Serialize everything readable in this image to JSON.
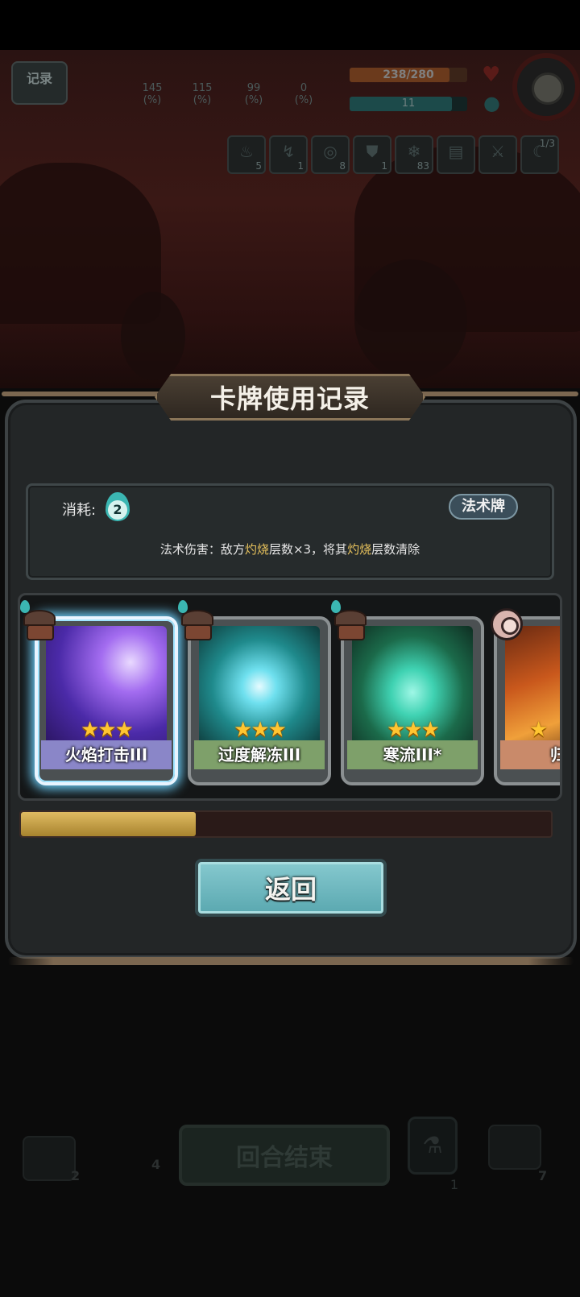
{
  "hud": {
    "record_label": "记录",
    "stats": [
      {
        "value": "145",
        "unit": "(%)"
      },
      {
        "value": "115",
        "unit": "(%)"
      },
      {
        "value": "99",
        "unit": "(%)"
      },
      {
        "value": "0",
        "unit": "(%)"
      }
    ],
    "hp_text": "238/280",
    "hp_fraction": 0.85,
    "mp_text": "11",
    "mp_fraction": 0.87,
    "buffs": [
      {
        "icon": "fire-icon",
        "count": "5"
      },
      {
        "icon": "lightning-icon",
        "count": "1"
      },
      {
        "icon": "target-icon",
        "count": "8"
      },
      {
        "icon": "shield-icon",
        "count": "1"
      },
      {
        "icon": "snowflake-icon",
        "count": "83"
      },
      {
        "icon": "book-icon",
        "count": ""
      },
      {
        "icon": "sword-icon",
        "count": ""
      },
      {
        "icon": "claw-icon",
        "count": "1/3"
      }
    ]
  },
  "modal": {
    "title": "卡牌使用记录",
    "cost_label": "消耗:",
    "cost_value": "2",
    "card_type": "法术牌",
    "description": {
      "p1": "法术伤害：敌方",
      "h1": "灼烧",
      "p2": "层数×3，将其",
      "h2": "灼烧",
      "p3": "层数清除"
    },
    "cards": [
      {
        "name": "火焰打击III",
        "stars": "★★★",
        "owner": "hat-hero",
        "selected": true,
        "color": "#8a86c8"
      },
      {
        "name": "过度解冻III",
        "stars": "★★★",
        "owner": "hat-hero",
        "selected": false,
        "color": "#7ea06a"
      },
      {
        "name": "寒流III*",
        "stars": "★★★",
        "owner": "hat-hero",
        "selected": false,
        "color": "#7ea06a"
      },
      {
        "name": "归",
        "stars": "★",
        "owner": "eyeball-enemy",
        "selected": false,
        "color": "#c98a6a"
      }
    ],
    "scroll_fraction": 0.33,
    "back_label": "返回"
  },
  "bottom": {
    "draw_count": "2",
    "discard_count": "4",
    "end_turn_label": "回合结束",
    "potion_count": "1",
    "exhaust_count": "7"
  }
}
